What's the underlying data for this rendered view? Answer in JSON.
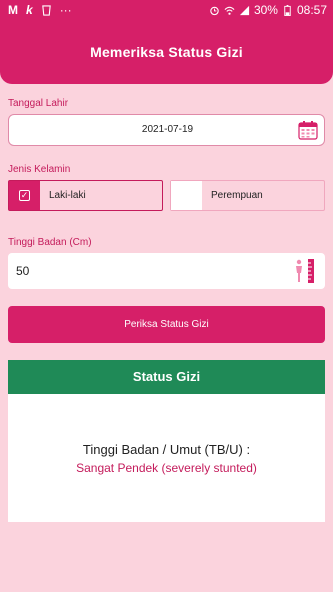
{
  "status_bar": {
    "left_icons": [
      "m-app-icon",
      "k-app-icon",
      "cup-icon",
      "more-dots-icon"
    ],
    "battery": "30%",
    "time": "08:57"
  },
  "header": {
    "title": "Memeriksa Status Gizi"
  },
  "birth_date": {
    "label": "Tanggal Lahir",
    "value": "2021-07-19"
  },
  "gender": {
    "label": "Jenis Kelamin",
    "options": [
      {
        "label": "Laki-laki",
        "selected": true
      },
      {
        "label": "Perempuan",
        "selected": false
      }
    ]
  },
  "height": {
    "label": "Tinggi Badan (Cm)",
    "value": "50"
  },
  "check_button": {
    "label": "Periksa Status Gizi"
  },
  "status": {
    "title": "Status Gizi",
    "result_label": "Tinggi Badan / Umut (TB/U) :",
    "result_value": "Sangat Pendek (severely stunted)"
  },
  "colors": {
    "primary": "#d61f68",
    "background": "#fbd3dd",
    "status_header": "#1f8a57"
  }
}
